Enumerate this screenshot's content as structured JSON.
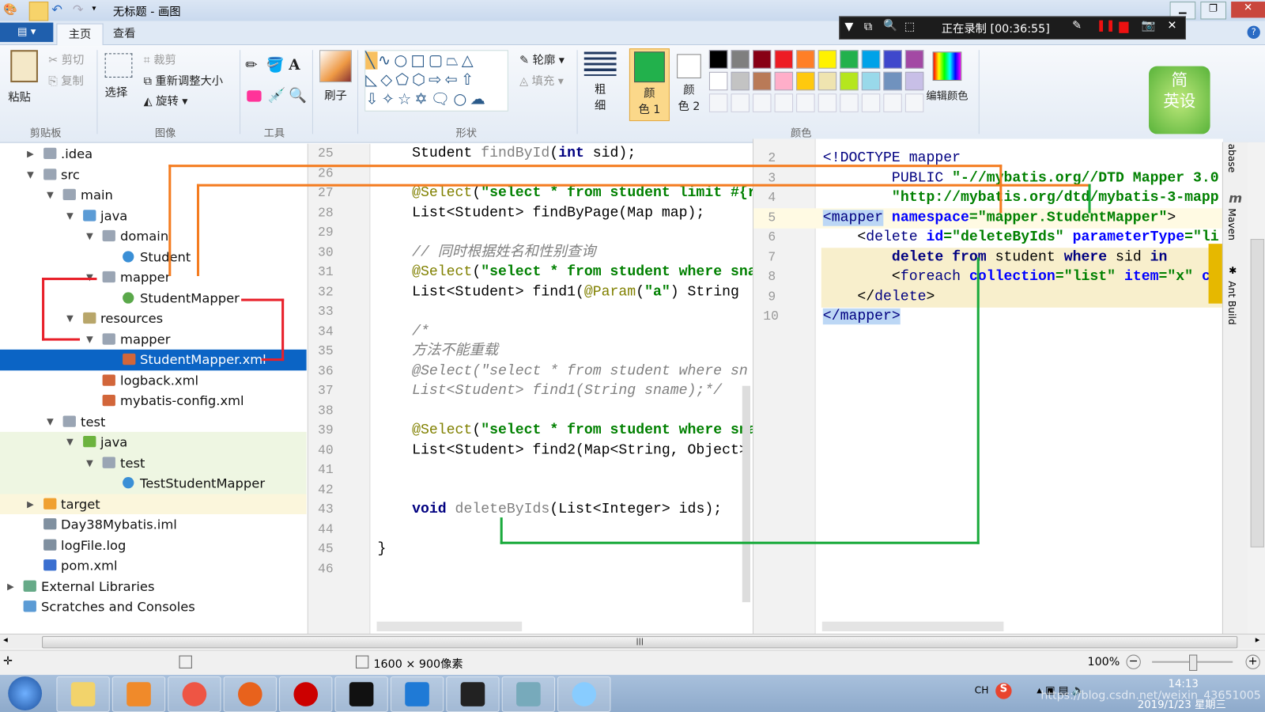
{
  "window": {
    "title": "无标题 - 画图"
  },
  "recorder": {
    "status": "正在录制 [00:36:55]"
  },
  "ribbon": {
    "file_menu": "",
    "tabs": [
      "主页",
      "查看"
    ],
    "clipboard": {
      "paste": "粘贴",
      "cut": "剪切",
      "copy": "复制",
      "label": "剪贴板"
    },
    "image": {
      "select": "选择",
      "crop": "裁剪",
      "resize": "重新调整大小",
      "rotate": "旋转",
      "label": "图像"
    },
    "tools": {
      "label": "工具"
    },
    "brush": {
      "label": "刷子"
    },
    "shapes": {
      "outline": "轮廓",
      "fill": "填充",
      "label": "形状"
    },
    "size": {
      "label_1": "粗",
      "label_2": "细"
    },
    "colors": {
      "color1_1": "颜",
      "color1_2": "色 1",
      "color2_1": "颜",
      "color2_2": "色 2",
      "edit": "编辑颜色",
      "label": "颜色",
      "row1": [
        "#000000",
        "#7f7f7f",
        "#880015",
        "#ed1c24",
        "#ff7f27",
        "#fff200",
        "#22b14c",
        "#00a2e8",
        "#3f48cc",
        "#a349a4"
      ],
      "row2": [
        "#ffffff",
        "#c3c3c3",
        "#b97a57",
        "#ffaec9",
        "#ffc90e",
        "#efe4b0",
        "#b5e61d",
        "#99d9ea",
        "#7092be",
        "#c8bfe7"
      ],
      "color1": "#22b14c",
      "color2": "#ffffff"
    },
    "logo": "简英设"
  },
  "tree": [
    {
      "label": ".idea",
      "level": 1,
      "arrow": "right",
      "icon": "folder"
    },
    {
      "label": "src",
      "level": 1,
      "arrow": "down",
      "icon": "folder"
    },
    {
      "label": "main",
      "level": 2,
      "arrow": "down",
      "icon": "folder"
    },
    {
      "label": "java",
      "level": 3,
      "arrow": "down",
      "icon": "folder-source"
    },
    {
      "label": "domain",
      "level": 4,
      "arrow": "down",
      "icon": "package"
    },
    {
      "label": "Student",
      "level": 5,
      "arrow": "",
      "icon": "class"
    },
    {
      "label": "mapper",
      "level": 4,
      "arrow": "down",
      "icon": "package"
    },
    {
      "label": "StudentMapper",
      "level": 5,
      "arrow": "",
      "icon": "interface"
    },
    {
      "label": "resources",
      "level": 3,
      "arrow": "down",
      "icon": "folder-resources"
    },
    {
      "label": "mapper",
      "level": 4,
      "arrow": "down",
      "icon": "folder"
    },
    {
      "label": "StudentMapper.xml",
      "level": 5,
      "arrow": "",
      "icon": "xml",
      "selected": true
    },
    {
      "label": "logback.xml",
      "level": 4,
      "arrow": "",
      "icon": "xml"
    },
    {
      "label": "mybatis-config.xml",
      "level": 4,
      "arrow": "",
      "icon": "xml"
    },
    {
      "label": "test",
      "level": 2,
      "arrow": "down",
      "icon": "folder"
    },
    {
      "label": "java",
      "level": 3,
      "arrow": "down",
      "icon": "folder-test",
      "bg": "green"
    },
    {
      "label": "test",
      "level": 4,
      "arrow": "down",
      "icon": "package",
      "bg": "green"
    },
    {
      "label": "TestStudentMapper",
      "level": 5,
      "arrow": "",
      "icon": "class",
      "bg": "green"
    },
    {
      "label": "target",
      "level": 1,
      "arrow": "right",
      "icon": "folder-excluded",
      "bg": "yellow"
    },
    {
      "label": "Day38Mybatis.iml",
      "level": 1,
      "arrow": "",
      "icon": "file"
    },
    {
      "label": "logFile.log",
      "level": 1,
      "arrow": "",
      "icon": "file"
    },
    {
      "label": "pom.xml",
      "level": 1,
      "arrow": "",
      "icon": "maven"
    },
    {
      "label": "External Libraries",
      "level": 0,
      "arrow": "right",
      "icon": "libraries"
    },
    {
      "label": "Scratches and Consoles",
      "level": 0,
      "arrow": "",
      "icon": "scratches"
    }
  ],
  "java_editor": {
    "lines": [
      {
        "n": "25",
        "t": [
          [
            "    Student ",
            "txt"
          ],
          [
            "findById",
            "unused"
          ],
          [
            "(",
            "txt"
          ],
          [
            "int",
            "kw"
          ],
          [
            " sid);",
            "txt"
          ]
        ]
      },
      {
        "n": "26",
        "t": []
      },
      {
        "n": "27",
        "t": [
          [
            "    ",
            "txt"
          ],
          [
            "@Select",
            "ann"
          ],
          [
            "(",
            "txt"
          ],
          [
            "\"select * from student limit #{r",
            "str"
          ]
        ]
      },
      {
        "n": "28",
        "t": [
          [
            "    List<Student> findByPage(Map map);",
            "txt"
          ]
        ]
      },
      {
        "n": "29",
        "t": []
      },
      {
        "n": "30",
        "t": [
          [
            "    // 同时根据姓名和性别查询",
            "cmt"
          ]
        ]
      },
      {
        "n": "31",
        "t": [
          [
            "    ",
            "txt"
          ],
          [
            "@Select",
            "ann"
          ],
          [
            "(",
            "txt"
          ],
          [
            "\"select * from student where sna",
            "str"
          ]
        ]
      },
      {
        "n": "32",
        "t": [
          [
            "    List<Student> find1(",
            "txt"
          ],
          [
            "@Param",
            "ann"
          ],
          [
            "(",
            "txt"
          ],
          [
            "\"a\"",
            "str"
          ],
          [
            ") String",
            "txt"
          ]
        ]
      },
      {
        "n": "33",
        "t": []
      },
      {
        "n": "34",
        "t": [
          [
            "    /*",
            "cmt"
          ]
        ]
      },
      {
        "n": "35",
        "t": [
          [
            "    方法不能重载",
            "cmt"
          ]
        ]
      },
      {
        "n": "36",
        "t": [
          [
            "    @Select(\"select * from student where sn",
            "cmt"
          ]
        ]
      },
      {
        "n": "37",
        "t": [
          [
            "    List<Student> find1(String sname);*/",
            "cmt"
          ]
        ]
      },
      {
        "n": "38",
        "t": []
      },
      {
        "n": "39",
        "t": [
          [
            "    ",
            "txt"
          ],
          [
            "@Select",
            "ann"
          ],
          [
            "(",
            "txt"
          ],
          [
            "\"select * from student where sna",
            "str"
          ]
        ]
      },
      {
        "n": "40",
        "t": [
          [
            "    List<Student> find2(Map<String, Object>",
            "txt"
          ]
        ]
      },
      {
        "n": "41",
        "t": []
      },
      {
        "n": "42",
        "t": []
      },
      {
        "n": "43",
        "t": [
          [
            "    ",
            "txt"
          ],
          [
            "void",
            "kw"
          ],
          [
            " ",
            "txt"
          ],
          [
            "deleteByIds",
            "unused"
          ],
          [
            "(List<Integer> ids);",
            "txt"
          ]
        ]
      },
      {
        "n": "44",
        "t": []
      },
      {
        "n": "45",
        "t": [
          [
            "}",
            "txt"
          ]
        ]
      },
      {
        "n": "46",
        "t": []
      }
    ]
  },
  "xml_editor": {
    "lines": [
      {
        "n": "2",
        "t": [
          [
            "<!DOCTYPE ",
            "tag"
          ],
          [
            "mapper",
            "tag"
          ]
        ]
      },
      {
        "n": "3",
        "t": [
          [
            "        ",
            "txt"
          ],
          [
            "PUBLIC ",
            "tag"
          ],
          [
            "\"-//mybatis.org//DTD Mapper 3.0",
            "xstr"
          ]
        ]
      },
      {
        "n": "4",
        "t": [
          [
            "        ",
            "txt"
          ],
          [
            "\"http://mybatis.org/dtd/mybatis-3-mapp",
            "xstr"
          ]
        ]
      },
      {
        "n": "5",
        "t": [
          [
            "<mapper",
            "tag hlbl"
          ],
          [
            " ",
            "txt"
          ],
          [
            "namespace",
            "attr"
          ],
          [
            "=\"mapper.StudentMapper\"",
            "xstr"
          ],
          [
            ">",
            "txt"
          ]
        ]
      },
      {
        "n": "6",
        "t": [
          [
            "    <",
            "txt"
          ],
          [
            "delete",
            "tag"
          ],
          [
            " ",
            "txt"
          ],
          [
            "id",
            "attr"
          ],
          [
            "=\"deleteByIds\"",
            "xstr"
          ],
          [
            " ",
            "txt"
          ],
          [
            "parameterType",
            "attr"
          ],
          [
            "=\"li",
            "xstr"
          ]
        ]
      },
      {
        "n": "7",
        "t": [
          [
            "        ",
            "txt"
          ],
          [
            "delete from",
            "kw"
          ],
          [
            " student ",
            "txt"
          ],
          [
            "where",
            "kw"
          ],
          [
            " sid ",
            "txt"
          ],
          [
            "in",
            "kw"
          ]
        ]
      },
      {
        "n": "8",
        "t": [
          [
            "        <",
            "txt"
          ],
          [
            "foreach",
            "tag"
          ],
          [
            " ",
            "txt"
          ],
          [
            "collection",
            "attr"
          ],
          [
            "=\"list\"",
            "xstr"
          ],
          [
            " ",
            "txt"
          ],
          [
            "item",
            "attr"
          ],
          [
            "=\"x\"",
            "xstr"
          ],
          [
            " c",
            "attr"
          ]
        ]
      },
      {
        "n": "9",
        "t": [
          [
            "    </",
            "txt"
          ],
          [
            "delete",
            "tag"
          ],
          [
            ">",
            "txt"
          ]
        ]
      },
      {
        "n": "10",
        "t": [
          [
            "</mapper>",
            "tag hlbl"
          ]
        ]
      }
    ]
  },
  "side_tools": [
    "abase",
    "Maven",
    "Ant Build"
  ],
  "statusbar": {
    "dimensions": "1600 × 900像素",
    "zoom": "100%",
    "zoom_level_percent": 100
  },
  "taskbar": {
    "apps": [
      "start",
      "explorer",
      "media-player",
      "chrome",
      "firefox",
      "recorder",
      "cmd",
      "vscode",
      "intellij",
      "paint",
      "chat"
    ],
    "ime": "CH",
    "time": "14:13",
    "date": "2019/1/23 星期三",
    "watermark": "https://blog.csdn.net/weixin_43651005"
  },
  "annotation_colors": {
    "orange": "#f47c20",
    "green": "#1aaa3c",
    "red": "#e8202a"
  }
}
